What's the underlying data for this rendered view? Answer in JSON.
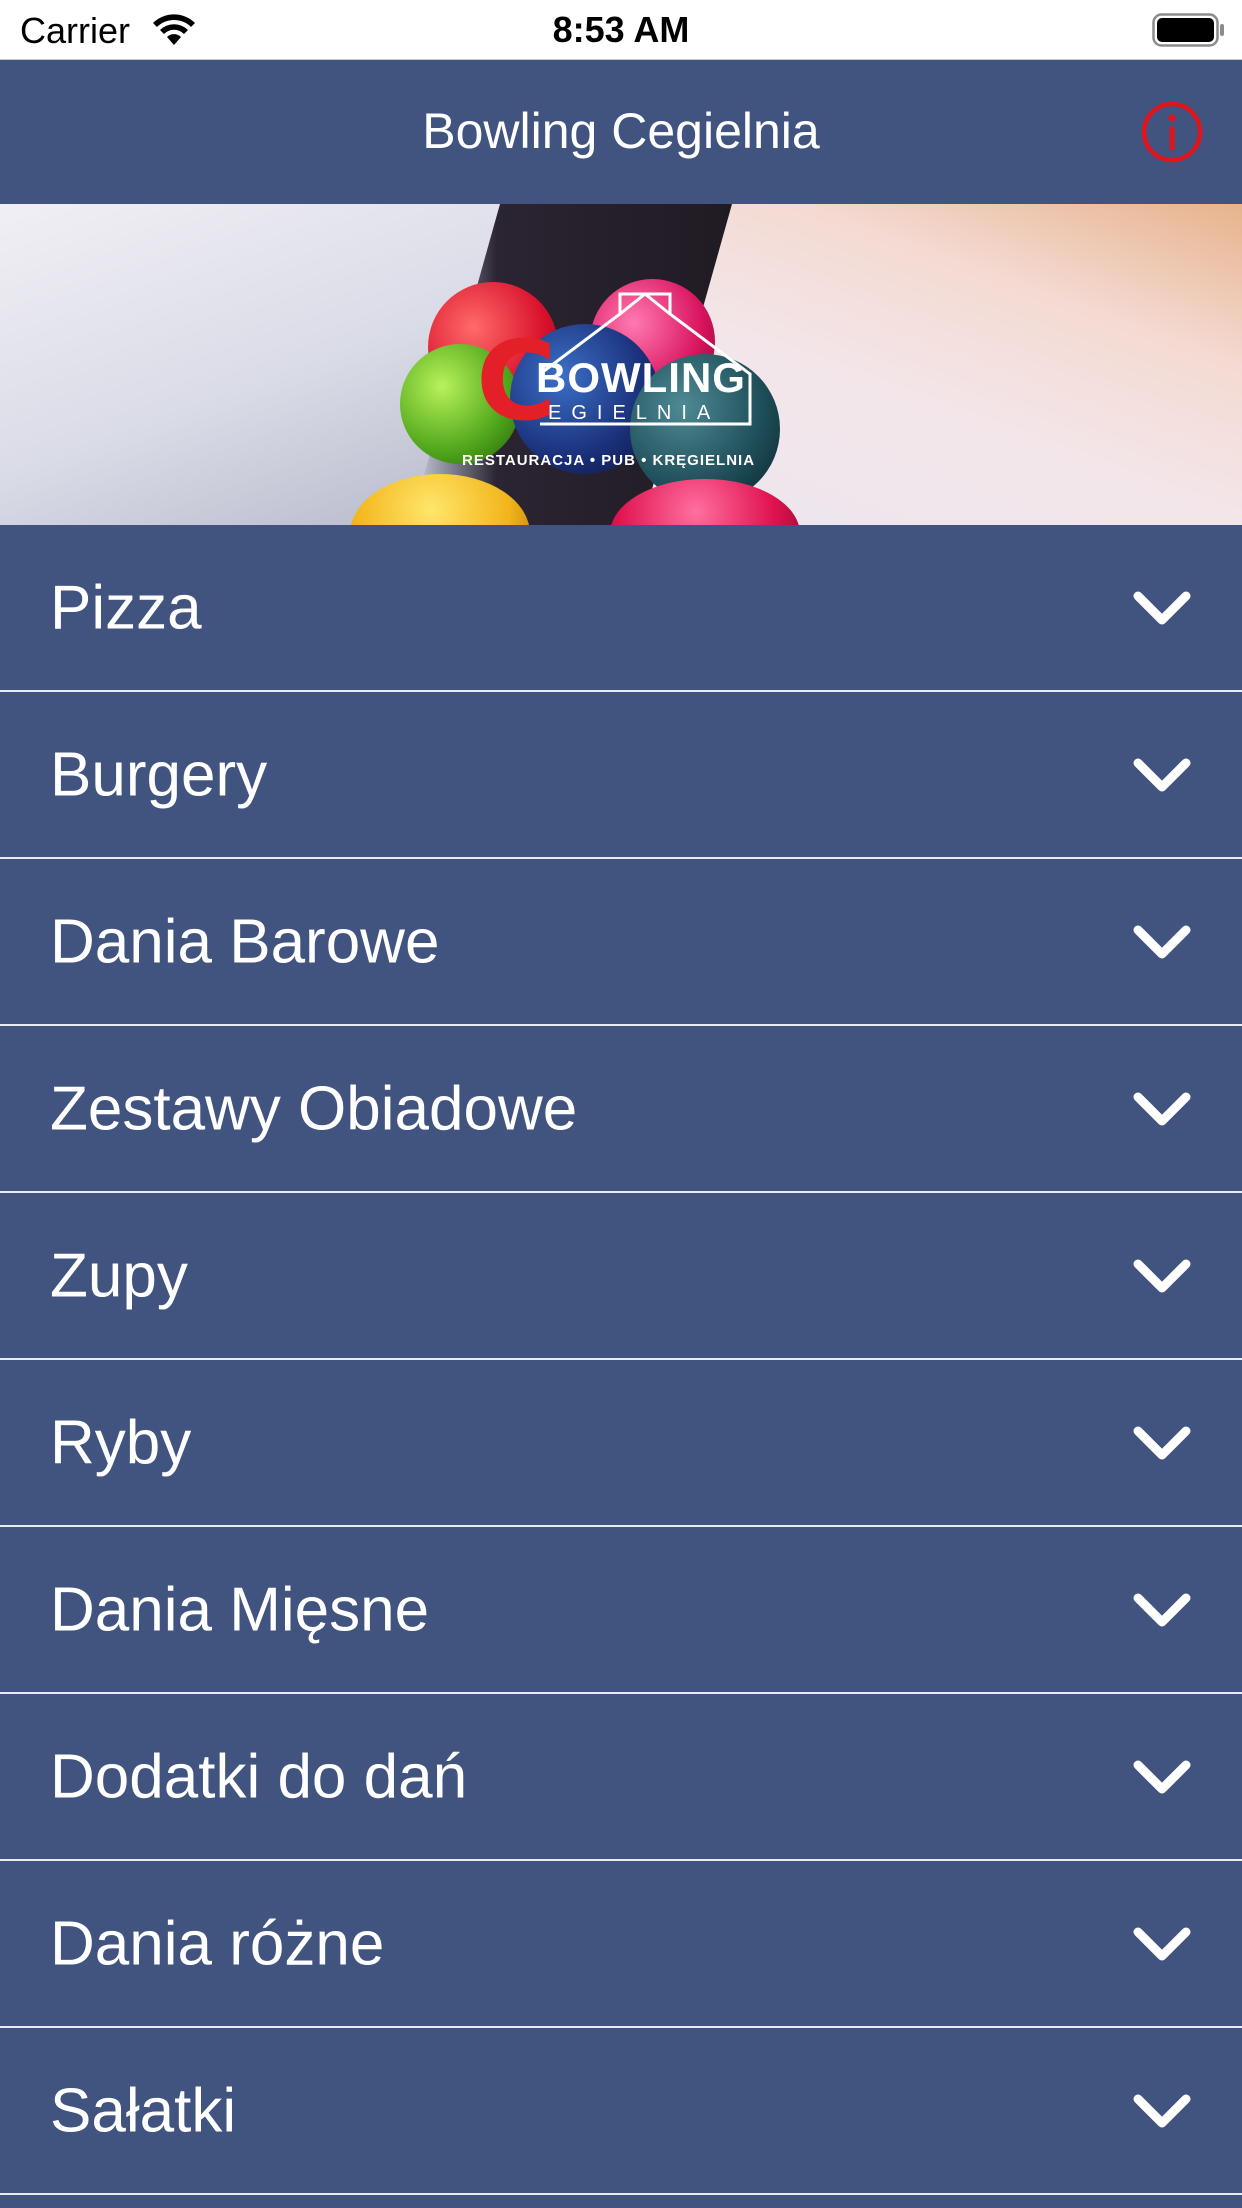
{
  "status_bar": {
    "carrier": "Carrier",
    "time": "8:53 AM",
    "icons": [
      "wifi-icon",
      "battery-icon"
    ]
  },
  "nav": {
    "title": "Bowling Cegielnia",
    "info_icon": "info-icon",
    "info_color": "#e0141c"
  },
  "banner": {
    "logo_initial": "C",
    "logo_word": "BOWLING",
    "logo_sub": "EGIELNIA",
    "logo_tagline": "RESTAURACJA • PUB • KRĘGIELNIA"
  },
  "colors": {
    "background": "#41547f",
    "divider": "#e9ecf3",
    "text": "#ffffff"
  },
  "menu": {
    "items": [
      {
        "label": "Pizza",
        "icon": "chevron-down-icon"
      },
      {
        "label": "Burgery",
        "icon": "chevron-down-icon"
      },
      {
        "label": "Dania Barowe",
        "icon": "chevron-down-icon"
      },
      {
        "label": "Zestawy Obiadowe",
        "icon": "chevron-down-icon"
      },
      {
        "label": "Zupy",
        "icon": "chevron-down-icon"
      },
      {
        "label": "Ryby",
        "icon": "chevron-down-icon"
      },
      {
        "label": "Dania Mięsne",
        "icon": "chevron-down-icon"
      },
      {
        "label": "Dodatki do dań",
        "icon": "chevron-down-icon"
      },
      {
        "label": "Dania różne",
        "icon": "chevron-down-icon"
      },
      {
        "label": "Sałatki",
        "icon": "chevron-down-icon"
      }
    ]
  }
}
